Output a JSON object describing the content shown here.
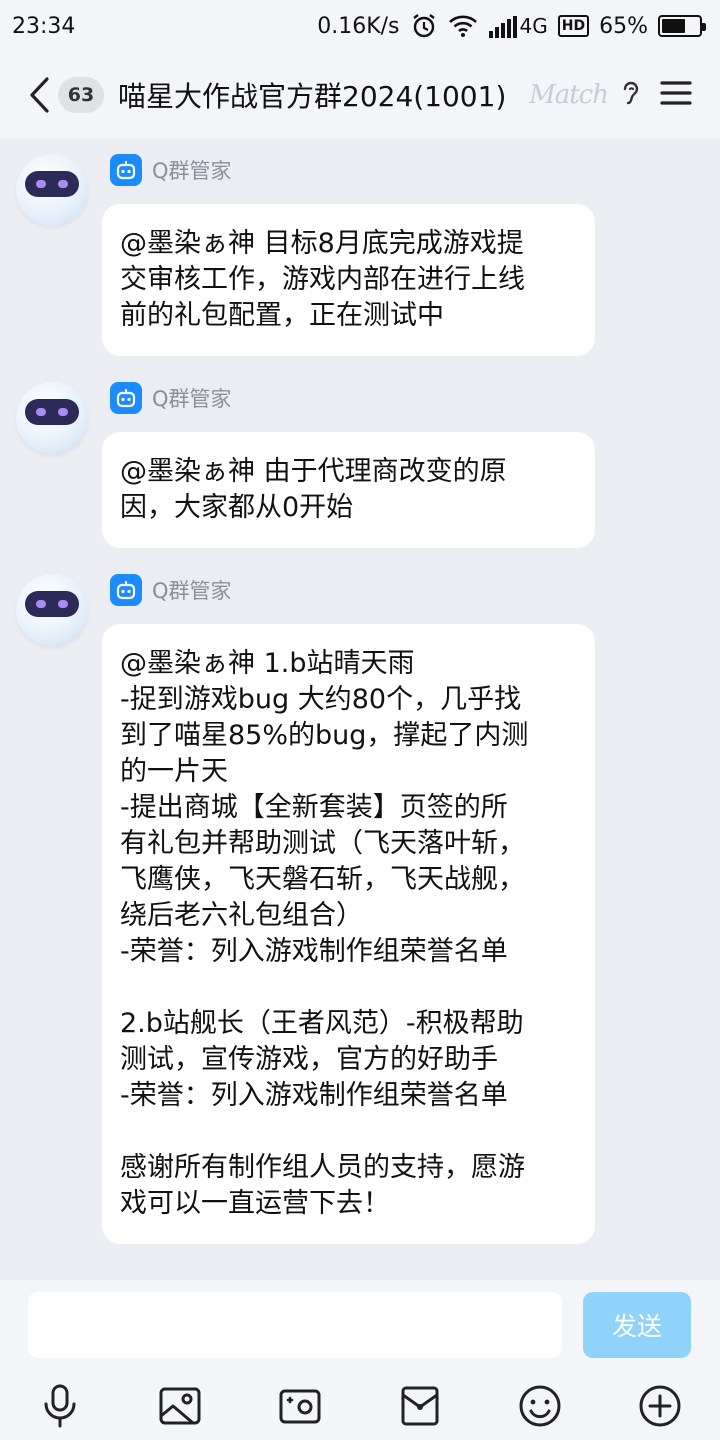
{
  "status": {
    "time": "23:34",
    "net_speed": "0.16K/s",
    "network": "4G",
    "hd": "HD",
    "battery_percent": "65%",
    "battery_level": 0.65
  },
  "header": {
    "unread_count": "63",
    "title": "喵星大作战官方群2024(1001)",
    "logo_text": "Match"
  },
  "messages": [
    {
      "sender": "Q群管家",
      "lines": [
        "@墨染ぁ神 目标8月底完成游戏提",
        "交审核工作，游戏内部在进行上线",
        "前的礼包配置，正在测试中"
      ]
    },
    {
      "sender": "Q群管家",
      "lines": [
        "@墨染ぁ神 由于代理商改变的原",
        "因，大家都从0开始"
      ]
    },
    {
      "sender": "Q群管家",
      "lines": [
        "@墨染ぁ神 1.b站晴天雨",
        "-捉到游戏bug 大约80个，几乎找",
        "到了喵星85%的bug，撑起了内测",
        "的一片天",
        "-提出商城【全新套装】页签的所",
        "有礼包并帮助测试（飞天落叶斩，",
        "飞鹰侠，飞天磐石斩，飞天战舰，",
        "绕后老六礼包组合）",
        "-荣誉：列入游戏制作组荣誉名单",
        "",
        "2.b站舰长（王者风范）-积极帮助",
        "测试，宣传游戏，官方的好助手",
        "-荣誉：列入游戏制作组荣誉名单",
        "",
        "感谢所有制作组人员的支持，愿游",
        "戏可以一直运营下去！"
      ]
    }
  ],
  "input": {
    "placeholder": "",
    "send_label": "发送"
  },
  "toolbar": [
    "microphone-icon",
    "image-icon",
    "camera-icon",
    "red-packet-icon",
    "emoji-icon",
    "plus-icon"
  ],
  "colors": {
    "accent": "#1a8cff",
    "send_disabled": "#8fd3fb",
    "background": "#ebedf2"
  }
}
